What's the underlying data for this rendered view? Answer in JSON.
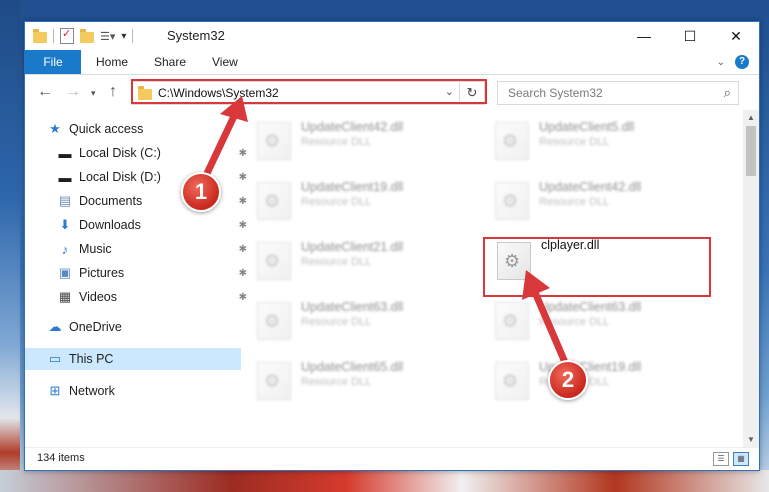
{
  "window": {
    "title": "System32",
    "controls": {
      "minimize": "—",
      "maximize": "☐",
      "close": "✕"
    }
  },
  "ribbon": {
    "tabs": [
      "File",
      "Home",
      "Share",
      "View"
    ],
    "help": "?"
  },
  "navigation": {
    "address": "C:\\Windows\\System32",
    "search_placeholder": "Search System32"
  },
  "sidebar": {
    "items": [
      {
        "label": "Quick access",
        "icon": "star-icon"
      },
      {
        "label": "Local Disk (C:)",
        "icon": "drive-icon"
      },
      {
        "label": "Local Disk (D:)",
        "icon": "drive-icon"
      },
      {
        "label": "Documents",
        "icon": "documents-icon"
      },
      {
        "label": "Downloads",
        "icon": "downloads-icon"
      },
      {
        "label": "Music",
        "icon": "music-icon"
      },
      {
        "label": "Pictures",
        "icon": "pictures-icon"
      },
      {
        "label": "Videos",
        "icon": "videos-icon"
      },
      {
        "label": "OneDrive",
        "icon": "onedrive-icon"
      },
      {
        "label": "This PC",
        "icon": "computer-icon"
      },
      {
        "label": "Network",
        "icon": "network-icon"
      }
    ]
  },
  "files": [
    {
      "name": "UpdateClient42.dll",
      "desc": "Resource DLL"
    },
    {
      "name": "UpdateClient5.dll",
      "desc": "Resource DLL"
    },
    {
      "name": "UpdateClient19.dll",
      "desc": "Resource DLL"
    },
    {
      "name": "UpdateClient42.dll",
      "desc": "Resource DLL"
    },
    {
      "name": "UpdateClient21.dll",
      "desc": "Resource DLL"
    },
    {
      "name": "clplayer.dll",
      "desc": ""
    },
    {
      "name": "UpdateClient63.dll",
      "desc": "Resource DLL"
    },
    {
      "name": "UpdateClient63.dll",
      "desc": "Resource DLL"
    },
    {
      "name": "UpdateClient65.dll",
      "desc": "Resource DLL"
    },
    {
      "name": "UpdateClient19.dll",
      "desc": "Resource DLL"
    }
  ],
  "status": {
    "item_count": "134 items"
  },
  "annotations": {
    "step1": "1",
    "step2": "2"
  },
  "colors": {
    "accent": "#1979ca",
    "highlight": "#d9383a",
    "selected": "#cce8ff"
  }
}
